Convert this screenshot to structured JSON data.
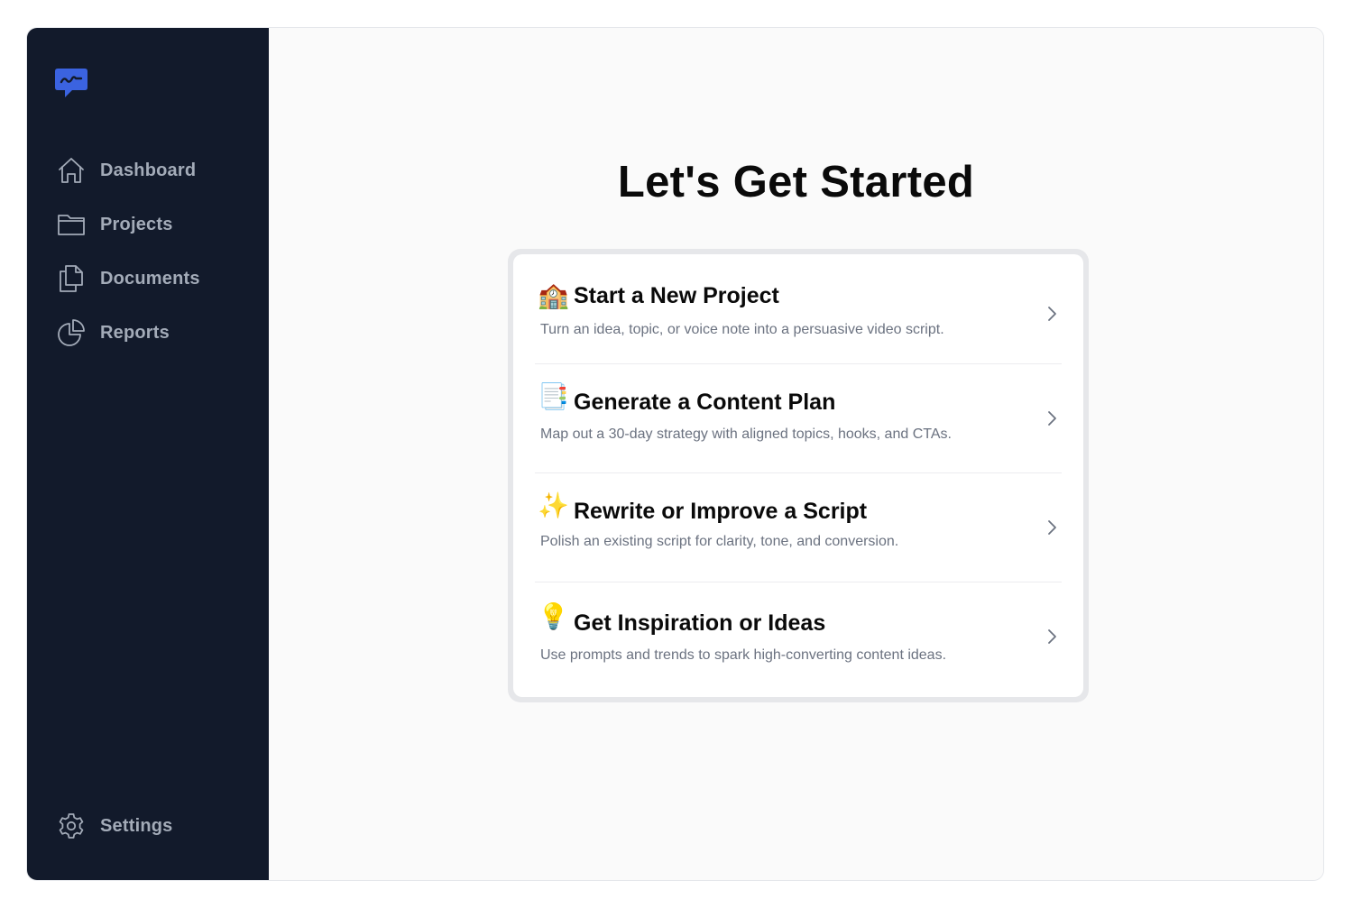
{
  "sidebar": {
    "logo_icon": "chat-bubble-logo-icon",
    "items": [
      {
        "label": "Dashboard",
        "icon": "home-icon"
      },
      {
        "label": "Projects",
        "icon": "folder-icon"
      },
      {
        "label": "Documents",
        "icon": "documents-icon"
      },
      {
        "label": "Reports",
        "icon": "pie-chart-icon"
      }
    ],
    "settings": {
      "label": "Settings",
      "icon": "gear-icon"
    }
  },
  "main": {
    "title": "Let's Get Started",
    "options": [
      {
        "emoji": "🏫",
        "title": "Start a New Project",
        "description": "Turn an idea, topic, or voice note into a persuasive video script."
      },
      {
        "emoji": "📑",
        "title": "Generate a Content Plan",
        "description": "Map out a 30-day strategy with aligned topics, hooks, and CTAs."
      },
      {
        "emoji": "✨",
        "title": "Rewrite or Improve a Script",
        "description": "Polish an existing script for clarity, tone, and conversion."
      },
      {
        "emoji": "💡",
        "title": "Get Inspiration or Ideas",
        "description": "Use prompts and trends to spark high-converting content ideas."
      }
    ]
  },
  "colors": {
    "sidebar_bg": "#121a2b",
    "accent": "#3b63e0",
    "nav_text": "#a3abb8",
    "main_bg": "#fafafa"
  }
}
